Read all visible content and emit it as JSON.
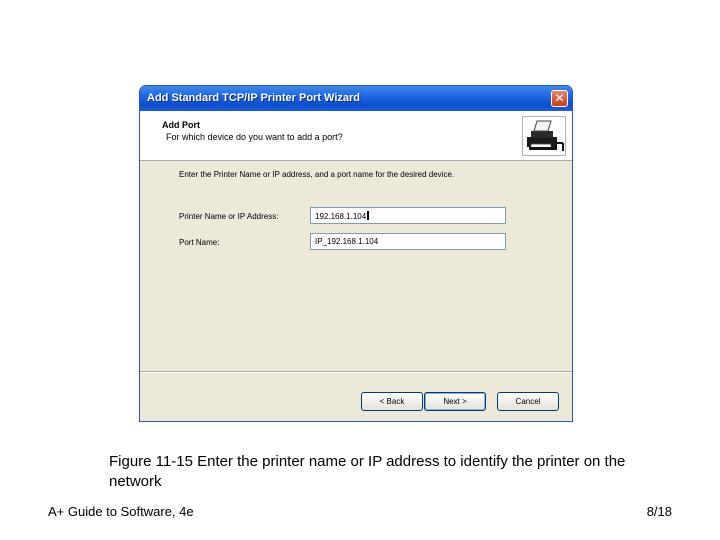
{
  "window": {
    "title": "Add Standard TCP/IP Printer Port Wizard",
    "close_glyph": "✕"
  },
  "header": {
    "title": "Add Port",
    "subtitle": "For which device do you want to add a port?",
    "icon": "printer-network-icon"
  },
  "body": {
    "instructions": "Enter the Printer Name or IP address, and a port name for the desired device.",
    "fields": [
      {
        "label": "Printer Name or IP Address:",
        "value": "192.168.1.104"
      },
      {
        "label": "Port Name:",
        "value": "IP_192.168.1.104"
      }
    ]
  },
  "buttons": {
    "back": "< Back",
    "next": "Next >",
    "cancel": "Cancel"
  },
  "caption": {
    "label": "Figure 11-15",
    "text": " Enter the printer name or IP address to identify the printer on the network"
  },
  "footer": {
    "left": "A+ Guide to Software, 4e",
    "right": "8/18"
  }
}
